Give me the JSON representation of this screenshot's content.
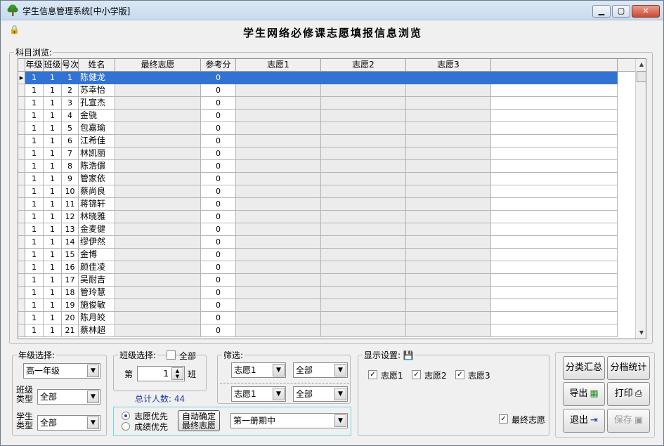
{
  "window": {
    "title": "学生信息管理系统[中小学版]",
    "min_glyph": "▁",
    "max_glyph": "▢",
    "close_glyph": "✕",
    "lock_glyph": "🔒"
  },
  "heading": "学生网络必修课志愿填报信息浏览",
  "subject_browse": {
    "legend": "科目浏览:",
    "columns": [
      "年级",
      "班级",
      "号次",
      "姓名",
      "最终志愿",
      "参考分",
      "志愿1",
      "志愿2",
      "志愿3"
    ],
    "rows": [
      [
        "1",
        "1",
        "1",
        "陈健龙",
        "",
        "0",
        "",
        "",
        ""
      ],
      [
        "1",
        "1",
        "2",
        "苏幸怡",
        "",
        "0",
        "",
        "",
        ""
      ],
      [
        "1",
        "1",
        "3",
        "孔宣杰",
        "",
        "0",
        "",
        "",
        ""
      ],
      [
        "1",
        "1",
        "4",
        "金骁",
        "",
        "0",
        "",
        "",
        ""
      ],
      [
        "1",
        "1",
        "5",
        "包嘉瑜",
        "",
        "0",
        "",
        "",
        ""
      ],
      [
        "1",
        "1",
        "6",
        "江希佳",
        "",
        "0",
        "",
        "",
        ""
      ],
      [
        "1",
        "1",
        "7",
        "林凯丽",
        "",
        "0",
        "",
        "",
        ""
      ],
      [
        "1",
        "1",
        "8",
        "陈浩儇",
        "",
        "0",
        "",
        "",
        ""
      ],
      [
        "1",
        "1",
        "9",
        "管家依",
        "",
        "0",
        "",
        "",
        ""
      ],
      [
        "1",
        "1",
        "10",
        "蔡尚良",
        "",
        "0",
        "",
        "",
        ""
      ],
      [
        "1",
        "1",
        "11",
        "蒋锦轩",
        "",
        "0",
        "",
        "",
        ""
      ],
      [
        "1",
        "1",
        "12",
        "林晓雅",
        "",
        "0",
        "",
        "",
        ""
      ],
      [
        "1",
        "1",
        "13",
        "金麦健",
        "",
        "0",
        "",
        "",
        ""
      ],
      [
        "1",
        "1",
        "14",
        "缪伊然",
        "",
        "0",
        "",
        "",
        ""
      ],
      [
        "1",
        "1",
        "15",
        "金博",
        "",
        "0",
        "",
        "",
        ""
      ],
      [
        "1",
        "1",
        "16",
        "颜佳凌",
        "",
        "0",
        "",
        "",
        ""
      ],
      [
        "1",
        "1",
        "17",
        "吴耐吉",
        "",
        "0",
        "",
        "",
        ""
      ],
      [
        "1",
        "1",
        "18",
        "管玲慧",
        "",
        "0",
        "",
        "",
        ""
      ],
      [
        "1",
        "1",
        "19",
        "施俊敏",
        "",
        "0",
        "",
        "",
        ""
      ],
      [
        "1",
        "1",
        "20",
        "陈月皎",
        "",
        "0",
        "",
        "",
        ""
      ],
      [
        "1",
        "1",
        "21",
        "蔡林超",
        "",
        "0",
        "",
        "",
        ""
      ]
    ],
    "selected_row": 0,
    "row_indicator": "▸",
    "scroll_up": "▲",
    "scroll_down": "▼"
  },
  "grade": {
    "legend": "年级选择:",
    "value": "高一年级",
    "class_type_label": "班级类型",
    "class_type_value": "全部",
    "student_type_label": "学生类型",
    "student_type_value": "全部"
  },
  "class_select": {
    "legend": "班级选择:",
    "all_label": "全部",
    "prefix": "第",
    "value": "1",
    "suffix": "班",
    "total": "总计人数: 44"
  },
  "filter": {
    "legend": "筛选:",
    "row1_a": "志愿1",
    "row1_b": "全部",
    "row2_a": "志愿1",
    "row2_b": "全部"
  },
  "priority": {
    "opt1": "志愿优先",
    "opt2": "成绩优先",
    "selected": "志愿优先",
    "auto_btn_line1": "自动确定",
    "auto_btn_line2": "最终志愿",
    "term_value": "第一册期中"
  },
  "display": {
    "legend": "显示设置:",
    "save_icon": "💾",
    "c1": "志愿1",
    "c2": "志愿2",
    "c3": "志愿3",
    "final": "最终志愿",
    "check": "✓"
  },
  "buttons": {
    "summary": "分类汇总",
    "archive_stats": "分档统计",
    "export": "导出",
    "export_icon": "▦",
    "print": "打印",
    "print_icon": "⎙",
    "exit": "退出",
    "exit_icon": "⇥",
    "save": "保存",
    "save_icon": "▣"
  },
  "colors": {
    "selection": "#3272d2",
    "total_text": "#1a3ea0"
  }
}
